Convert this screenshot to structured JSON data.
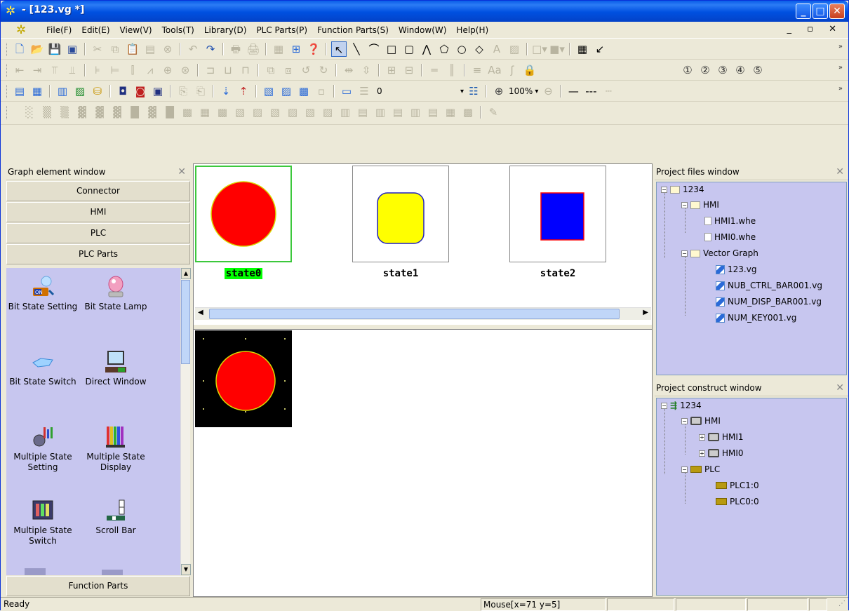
{
  "window": {
    "title": " - [123.vg *]",
    "min_label": "_",
    "max_label": "□",
    "close_label": "✕"
  },
  "menu": {
    "items": [
      "File(F)",
      "Edit(E)",
      "View(V)",
      "Tools(T)",
      "Library(D)",
      "PLC Parts(P)",
      "Function Parts(S)",
      "Window(W)",
      "Help(H)"
    ],
    "mdi_controls": "_ ▫ ✕"
  },
  "toolbar": {
    "edit_value": "0",
    "zoom_value": "100%"
  },
  "left_panel": {
    "title": "Graph element window",
    "categories": [
      "Connector",
      "HMI",
      "PLC",
      "PLC Parts"
    ],
    "parts": [
      {
        "label": "Bit State Setting",
        "icon": "bit-state-setting-icon"
      },
      {
        "label": "Bit State Lamp",
        "icon": "bit-state-lamp-icon"
      },
      {
        "label": "Bit State Switch",
        "icon": "bit-state-switch-icon"
      },
      {
        "label": "Direct Window",
        "icon": "direct-window-icon"
      },
      {
        "label": "Multiple State Setting",
        "icon": "multiple-state-setting-icon"
      },
      {
        "label": "Multiple State Display",
        "icon": "multiple-state-display-icon"
      },
      {
        "label": "Multiple State Switch",
        "icon": "multiple-state-switch-icon"
      },
      {
        "label": "Scroll Bar",
        "icon": "scroll-bar-icon"
      }
    ],
    "bottom_category": "Function Parts"
  },
  "states": [
    {
      "label": "state0",
      "shape": "circle",
      "fill": "#ff0000",
      "stroke": "#d8d800",
      "selected": true
    },
    {
      "label": "state1",
      "shape": "rounded-square",
      "fill": "#ffff00",
      "stroke": "#2020c0",
      "selected": false
    },
    {
      "label": "state2",
      "shape": "square",
      "fill": "#0000ff",
      "stroke": "#ff0000",
      "selected": false
    }
  ],
  "project_files": {
    "title": "Project files window",
    "root": "1234",
    "hmi_folder": "HMI",
    "hmi_files": [
      "HMI1.whe",
      "HMI0.whe"
    ],
    "vg_folder": "Vector Graph",
    "vg_files": [
      "123.vg",
      "NUB_CTRL_BAR001.vg",
      "NUM_DISP_BAR001.vg",
      "NUM_KEY001.vg"
    ]
  },
  "project_construct": {
    "title": "Project construct window",
    "root": "1234",
    "hmi_node": "HMI",
    "hmi_children": [
      "HMI1",
      "HMI0"
    ],
    "plc_node": "PLC",
    "plc_children": [
      "PLC1:0",
      "PLC0:0"
    ]
  },
  "status": {
    "ready": "Ready",
    "mouse": "Mouse[x=71  y=5]"
  }
}
